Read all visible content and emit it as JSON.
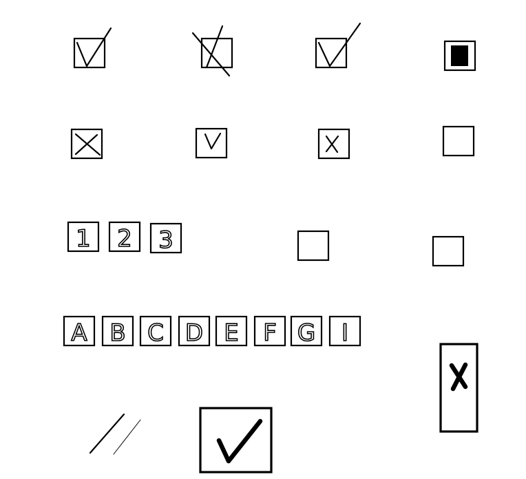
{
  "numbered_boxes": [
    "1",
    "2",
    "3"
  ],
  "lettered_boxes": [
    "A",
    "B",
    "C",
    "D",
    "E",
    "F",
    "G",
    "I"
  ]
}
